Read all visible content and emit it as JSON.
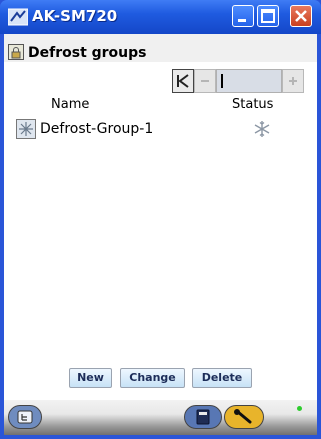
{
  "window": {
    "title": "AK-SM720"
  },
  "page": {
    "title": "Defrost groups"
  },
  "table": {
    "columns": [
      "Name",
      "Status"
    ],
    "rows": [
      {
        "name": "Defrost-Group-1",
        "status_icon": "snowflake-icon"
      }
    ]
  },
  "actions": {
    "new_label": "New",
    "change_label": "Change",
    "delete_label": "Delete"
  },
  "colors": {
    "titlebar": "#1f5be0",
    "button_bg": "#c7e2f6",
    "status_led": "#2ecc2e"
  }
}
